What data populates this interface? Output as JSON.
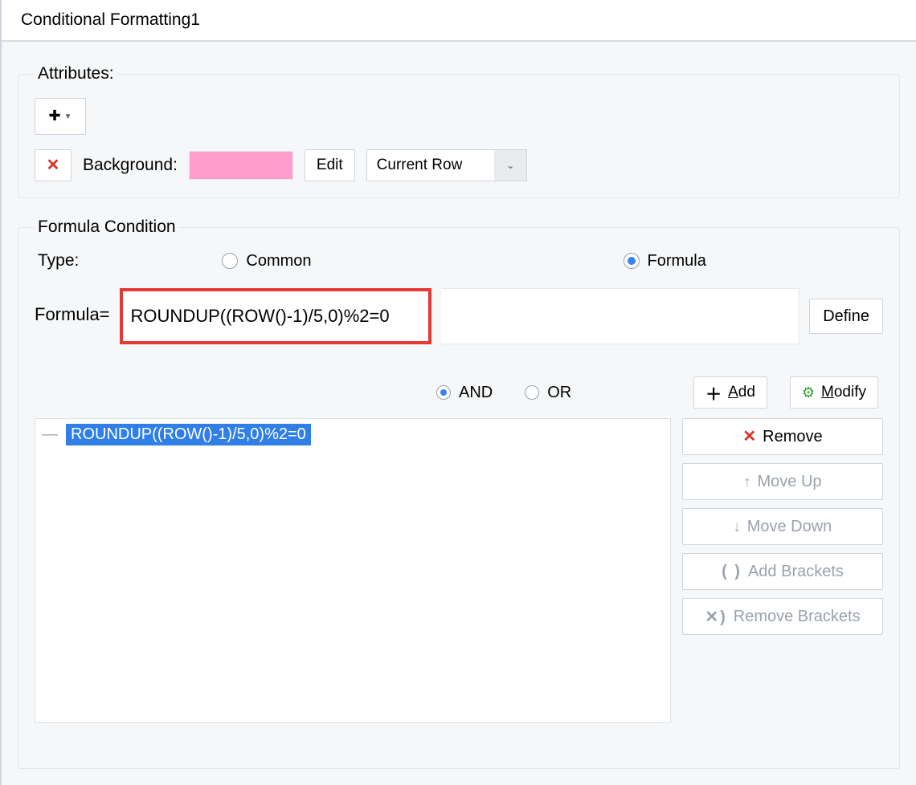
{
  "dialog": {
    "title": "Conditional Formatting1"
  },
  "attributes": {
    "legend": "Attributes:",
    "label_background": "Background:",
    "swatch_color": "#ff9ecd",
    "edit_label": "Edit",
    "scope_selected": "Current Row"
  },
  "formula": {
    "legend": "Formula Condition",
    "type_label": "Type:",
    "type_options": {
      "common": "Common",
      "formula": "Formula",
      "selected": "formula"
    },
    "formula_label": "Formula=",
    "formula_value": "ROUNDUP((ROW()-1)/5,0)%2=0",
    "define_label": "Define",
    "logic": {
      "and": "AND",
      "or": "OR",
      "selected": "and"
    },
    "buttons": {
      "add": "Add",
      "modify": "Modify",
      "remove": "Remove",
      "move_up": "Move Up",
      "move_down": "Move Down",
      "add_brackets": "Add Brackets",
      "remove_brackets": "Remove Brackets"
    },
    "list": [
      "ROUNDUP((ROW()-1)/5,0)%2=0"
    ]
  }
}
